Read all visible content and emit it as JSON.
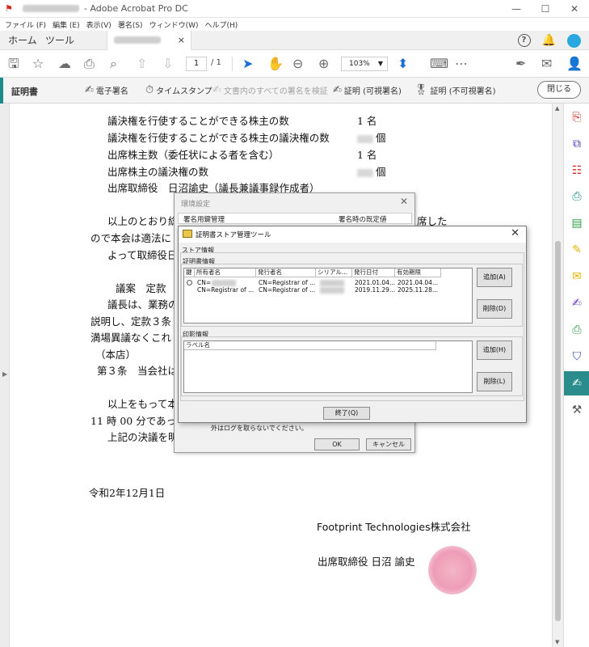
{
  "window": {
    "title": "- Adobe Acrobat Pro DC",
    "controls": [
      "—",
      "☐",
      "✕"
    ]
  },
  "menu": [
    "ファイル (F)",
    "編集 (E)",
    "表示(V)",
    "署名(S)",
    "ウィンドウ(W)",
    "ヘルプ(H)"
  ],
  "tabs": {
    "home": "ホーム",
    "tools": "ツール",
    "close": "×"
  },
  "toolbar": {
    "page_current": "1",
    "page_total": "/ 1",
    "zoom": "103%"
  },
  "certbar": {
    "title": "証明書",
    "items": [
      "電子署名",
      "タイムスタンプ",
      "文書内のすべての署名を検証",
      "証明 (可視署名)",
      "証明 (不可視署名)"
    ],
    "close": "閉じる"
  },
  "document": {
    "lines": [
      "議決権を行使することができる株主の数",
      "議決権を行使することができる株主の議決権の数",
      "出席株主数（委任状による者を含む）",
      "出席株主の議決権の数",
      "出席取締役　日沼諭史（議長兼議事録作成者）",
      "以上のとおり総",
      "ので本会は適法に",
      "よって取締役日",
      "議案　定款",
      "議長は、業務の",
      "説明し、定款３条",
      "満場異議なくこれ",
      "（本店）",
      "第３条　当会社は",
      "以上をもって本",
      "11 時 00 分であっ",
      "上記の決議を明",
      "令和2年12月1日",
      "Footprint Technologies株式会社",
      "出席取締役 日沼 諭史"
    ],
    "values": [
      "1 名",
      "個",
      "1 名",
      "個"
    ],
    "right_fragment": "席した"
  },
  "dialog_settings": {
    "title": "環境設定",
    "col1": "署名用鍵管理",
    "col2": "署名時の既定値",
    "note": "外はログを取らないでください。",
    "ok": "OK",
    "cancel": "キャンセル"
  },
  "dialog_store": {
    "title": "証明書ストア管理ツール",
    "store_label": "ストア情報",
    "cert_label": "証明書情報",
    "cert_columns": [
      "鍵",
      "所有者名",
      "発行者名",
      "シリアル...",
      "発行日付",
      "有効期限"
    ],
    "cert_rows": [
      {
        "owner": "CN=",
        "issuer": "CN=Registrar of ...",
        "issued": "2021.01.04...",
        "expires": "2021.04.04..."
      },
      {
        "owner": "CN=Registrar of ...",
        "issuer": "CN=Registrar of ...",
        "issued": "2019.11.29...",
        "expires": "2025.11.28..."
      }
    ],
    "seal_label": "印影情報",
    "seal_columns": [
      "ラベル名"
    ],
    "add": "追加(A)",
    "delete": "削除(D)",
    "add_h": "追加(H)",
    "delete_l": "削除(L)",
    "end": "終了(Q)"
  },
  "colors": {
    "accent": "#2a8c8c",
    "stamp": "#ee9cb7"
  },
  "icons": [
    "save-icon",
    "star-icon",
    "upload-icon",
    "print-icon",
    "zoom-icon",
    "page-up-icon",
    "page-down-icon",
    "select-arrow-icon",
    "hand-icon",
    "zoom-out-icon",
    "zoom-in-icon",
    "fit-icon",
    "scroll-icon",
    "more-icon",
    "sign-icon",
    "mail-icon",
    "add-user-icon"
  ]
}
